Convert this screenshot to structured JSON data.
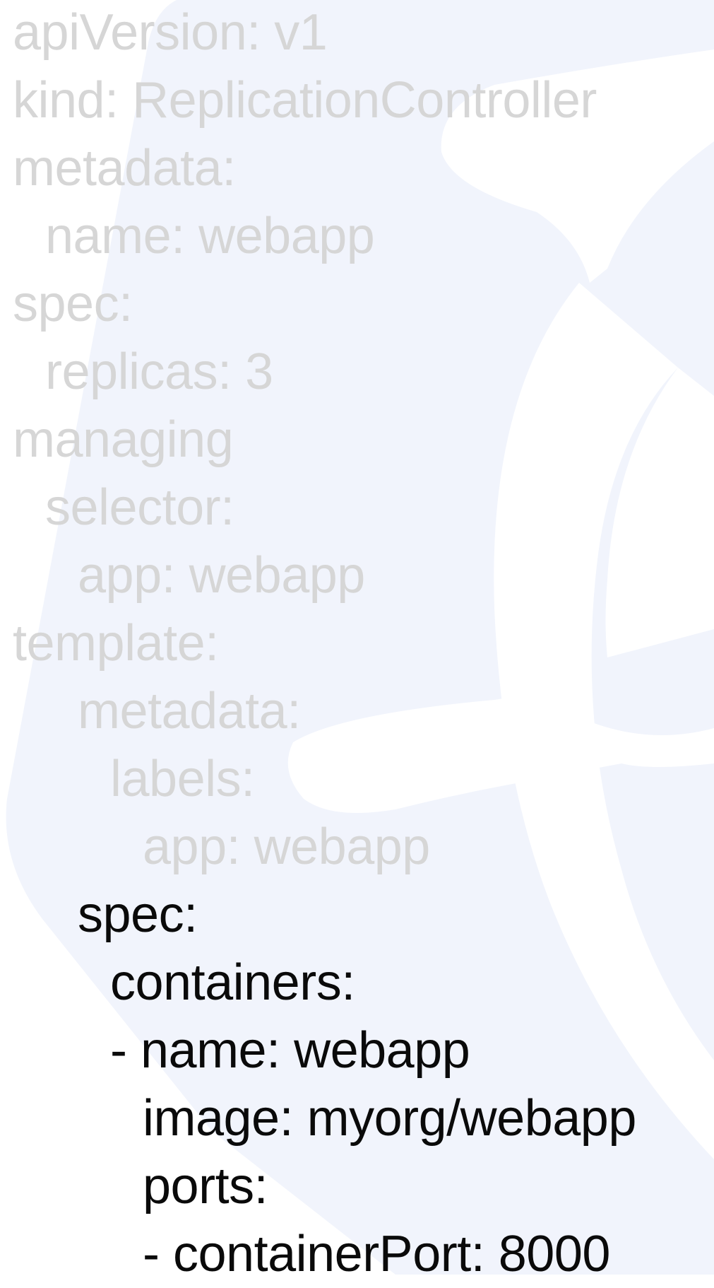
{
  "colors": {
    "background": "#ffffff",
    "logo_tint": "#f1f4fc",
    "dimmed_text": "#d6d6d6",
    "highlight_text": "#0a0a0a"
  },
  "background_icon": "kubernetes-helm-wheel-icon",
  "yaml": {
    "lines": [
      {
        "text": "apiVersion: v1",
        "state": "dimmed"
      },
      {
        "text": "kind: ReplicationController",
        "state": "dimmed"
      },
      {
        "text": "metadata:",
        "state": "dimmed"
      },
      {
        "text": "name: webapp",
        "state": "dimmed"
      },
      {
        "text": "spec:",
        "state": "dimmed"
      },
      {
        "text": "replicas: 3",
        "state": "dimmed"
      },
      {
        "text": "managing",
        "state": "dimmed"
      },
      {
        "text": "selector:",
        "state": "dimmed"
      },
      {
        "text": "app: webapp",
        "state": "dimmed"
      },
      {
        "text": "template:",
        "state": "dimmed"
      },
      {
        "text": "metadata:",
        "state": "dimmed"
      },
      {
        "text": "labels:",
        "state": "dimmed"
      },
      {
        "text": "app: webapp",
        "state": "dimmed"
      },
      {
        "text": "spec:",
        "state": "highlighted"
      },
      {
        "text": "containers:",
        "state": "highlighted"
      },
      {
        "text": "- name: webapp",
        "state": "highlighted"
      },
      {
        "text": "image: myorg/webapp",
        "state": "highlighted"
      },
      {
        "text": "ports:",
        "state": "highlighted"
      },
      {
        "text": "- containerPort: 8000",
        "state": "highlighted"
      }
    ]
  }
}
